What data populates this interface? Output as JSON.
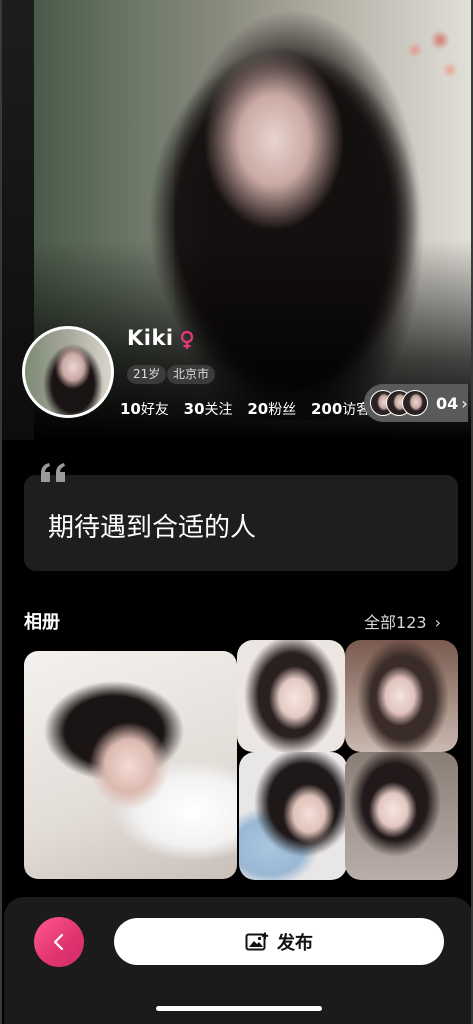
{
  "profile": {
    "name": "Kiki",
    "age": "21岁",
    "city": "北京市",
    "stats": [
      {
        "value": "10",
        "label": "好友"
      },
      {
        "value": "30",
        "label": "关注"
      },
      {
        "value": "20",
        "label": "粉丝"
      },
      {
        "value": "200",
        "label": "访客"
      }
    ],
    "visitor_count": "04",
    "gender_icon": "female-icon",
    "accent_color": "#e8387b"
  },
  "bio": {
    "text": "期待遇到合适的人"
  },
  "album": {
    "title": "相册",
    "all_label": "全部123"
  },
  "toolbar": {
    "publish_label": "发布",
    "back_icon": "chevron-left-icon",
    "publish_icon": "image-add-icon"
  }
}
